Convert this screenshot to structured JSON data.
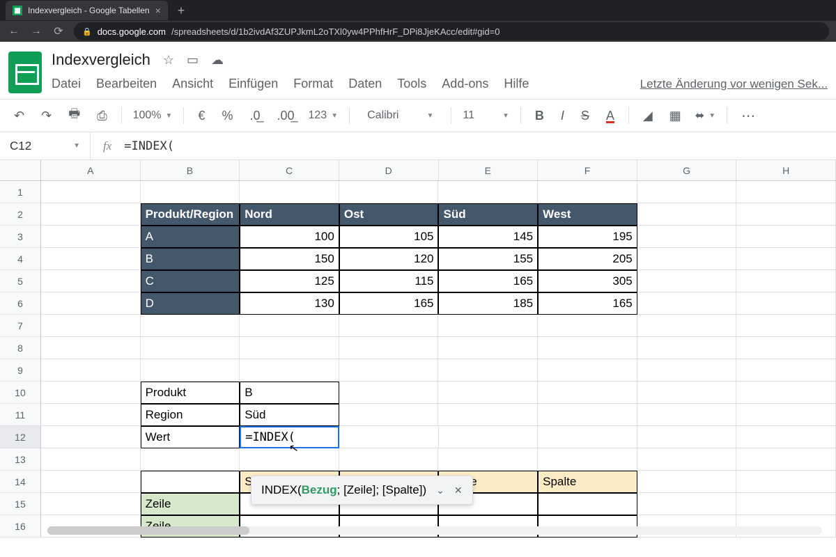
{
  "browser": {
    "tab_title": "Indexvergleich - Google Tabellen",
    "url_host": "docs.google.com",
    "url_path": "/spreadsheets/d/1b2ivdAf3ZUPJkmL2oTXl0yw4PPhfHrF_DPi8JjeKAcc/edit#gid=0"
  },
  "doc": {
    "title": "Indexvergleich",
    "last_edit": "Letzte Änderung vor wenigen Sek..."
  },
  "menu": {
    "datei": "Datei",
    "bearbeiten": "Bearbeiten",
    "ansicht": "Ansicht",
    "einfugen": "Einfügen",
    "format": "Format",
    "daten": "Daten",
    "tools": "Tools",
    "addons": "Add-ons",
    "hilfe": "Hilfe"
  },
  "toolbar": {
    "zoom": "100%",
    "currency": "€",
    "percent": "%",
    "dec_dec": ".0",
    "dec_inc": ".00",
    "numfmt": "123",
    "font": "Calibri",
    "size": "11",
    "bold": "B",
    "italic": "I",
    "strike": "S",
    "textcolor": "A"
  },
  "namebox": "C12",
  "formula": "=INDEX(",
  "columns": [
    "A",
    "B",
    "C",
    "D",
    "E",
    "F",
    "G",
    "H"
  ],
  "rows": [
    "1",
    "2",
    "3",
    "4",
    "5",
    "6",
    "7",
    "8",
    "9",
    "10",
    "11",
    "12",
    "13",
    "14",
    "15",
    "16"
  ],
  "table": {
    "header": [
      "Produkt/Region",
      "Nord",
      "Ost",
      "Süd",
      "West"
    ],
    "rows": [
      {
        "p": "A",
        "v": [
          "100",
          "105",
          "145",
          "195"
        ]
      },
      {
        "p": "B",
        "v": [
          "150",
          "120",
          "155",
          "205"
        ]
      },
      {
        "p": "C",
        "v": [
          "125",
          "115",
          "165",
          "305"
        ]
      },
      {
        "p": "D",
        "v": [
          "130",
          "165",
          "185",
          "165"
        ]
      }
    ]
  },
  "lookup": {
    "produkt_lbl": "Produkt",
    "produkt_val": "B",
    "region_lbl": "Region",
    "region_val": "Süd",
    "wert_lbl": "Wert",
    "wert_val": "=INDEX("
  },
  "matrix": {
    "spalte": "Spalte",
    "zeile": "Zeile"
  },
  "tooltip": {
    "fn": "INDEX(",
    "bezug": "Bezug",
    "rest": "; [Zeile]; [Spalte])"
  }
}
